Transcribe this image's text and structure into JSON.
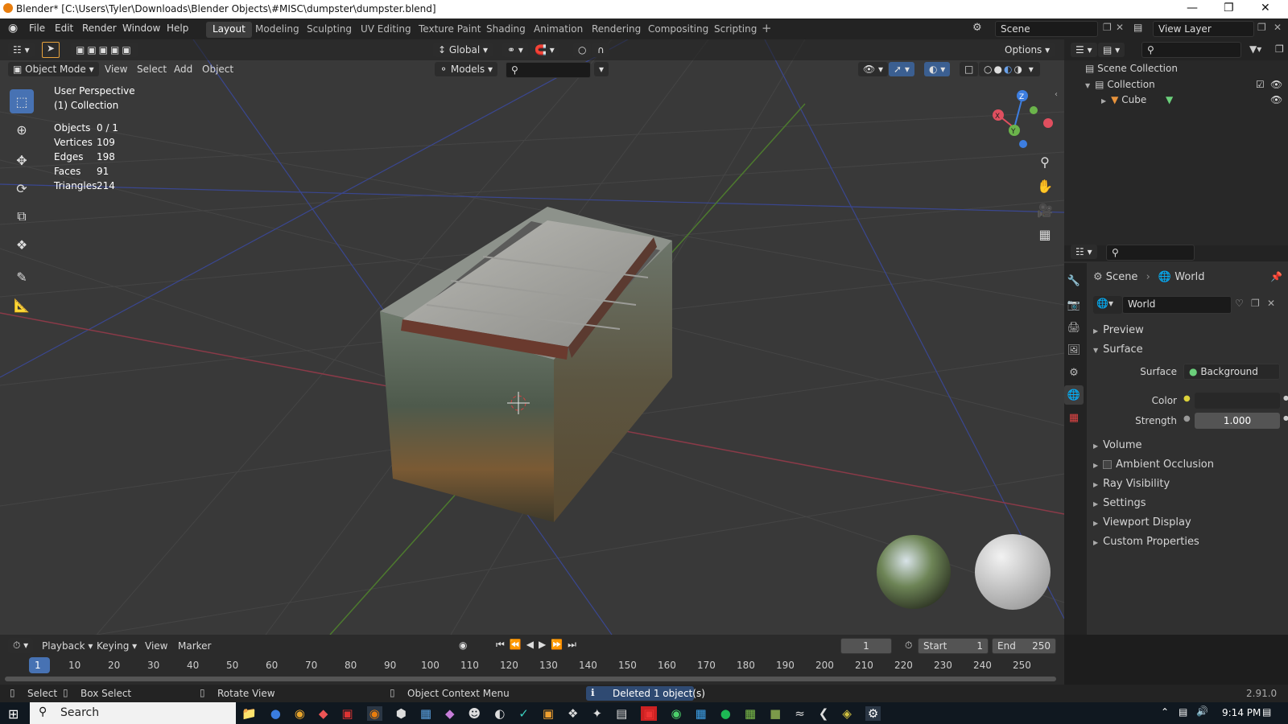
{
  "window": {
    "title": "Blender* [C:\\Users\\Tyler\\Downloads\\Blender Objects\\#MISC\\dumpster\\dumpster.blend]"
  },
  "menu": [
    "File",
    "Edit",
    "Render",
    "Window",
    "Help"
  ],
  "workspaces": [
    "Layout",
    "Modeling",
    "Sculpting",
    "UV Editing",
    "Texture Paint",
    "Shading",
    "Animation",
    "Rendering",
    "Compositing",
    "Scripting"
  ],
  "scene": {
    "name": "Scene",
    "view_layer": "View Layer"
  },
  "viewport": {
    "mode": "Object Mode",
    "menus": [
      "View",
      "Select",
      "Add",
      "Object"
    ],
    "orientation": "Global",
    "collection_filter": "Models",
    "options": "Options",
    "perspective": "User Perspective",
    "collection": "(1) Collection",
    "stats": [
      {
        "label": "Objects",
        "value": "0 / 1"
      },
      {
        "label": "Vertices",
        "value": "109"
      },
      {
        "label": "Edges",
        "value": "198"
      },
      {
        "label": "Faces",
        "value": "91"
      },
      {
        "label": "Triangles",
        "value": "214"
      }
    ],
    "gizmo_axes": {
      "x": "X",
      "y": "Y",
      "z": "Z"
    }
  },
  "outliner": {
    "root": "Scene Collection",
    "collection": "Collection",
    "object": "Cube"
  },
  "properties": {
    "breadcrumb": [
      "Scene",
      "World"
    ],
    "datablock": "World",
    "panels": [
      "Preview",
      "Surface",
      "Volume",
      "Ambient Occlusion",
      "Ray Visibility",
      "Settings",
      "Viewport Display",
      "Custom Properties"
    ],
    "surface_label": "Surface",
    "surface_value": "Background",
    "color_label": "Color",
    "strength_label": "Strength",
    "strength_value": "1.000"
  },
  "timeline": {
    "menus": [
      "Playback",
      "Keying",
      "View",
      "Marker"
    ],
    "current_frame": "1",
    "start_label": "Start",
    "start_value": "1",
    "end_label": "End",
    "end_value": "250",
    "ruler": [
      "1",
      "10",
      "20",
      "30",
      "40",
      "50",
      "60",
      "70",
      "80",
      "90",
      "100",
      "110",
      "120",
      "130",
      "140",
      "150",
      "160",
      "170",
      "180",
      "190",
      "200",
      "210",
      "220",
      "230",
      "240",
      "250"
    ]
  },
  "status": {
    "select": "Select",
    "box_select": "Box Select",
    "rotate_view": "Rotate View",
    "context_menu": "Object Context Menu",
    "message": "Deleted 1 object(s)",
    "version": "2.91.0"
  },
  "taskbar": {
    "search": "Search",
    "time": "9:14 PM"
  },
  "colors": {
    "accent": "#4772b3",
    "x_axis": "#e04f5f",
    "y_axis": "#6bb44b",
    "z_axis": "#3d7ee0"
  }
}
